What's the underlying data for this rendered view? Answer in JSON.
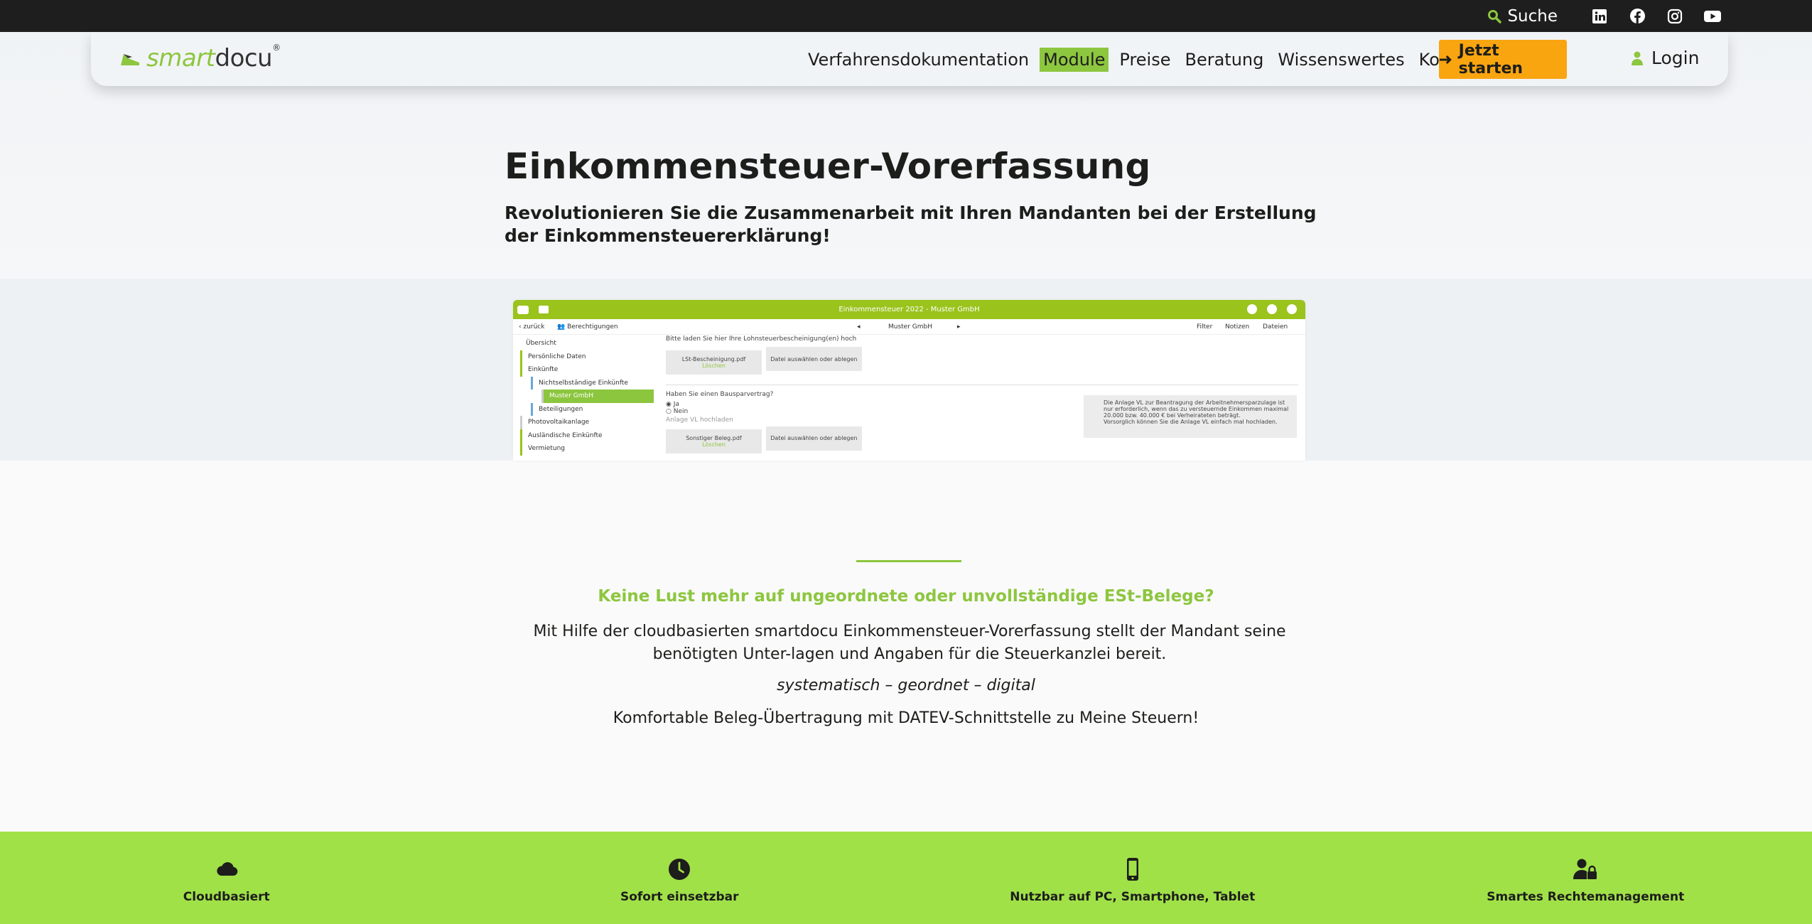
{
  "topbar": {
    "search_label": "Suche",
    "social": [
      "linkedin-icon",
      "facebook-icon",
      "instagram-icon",
      "youtube-icon"
    ]
  },
  "nav": {
    "logo_part1": "smart",
    "logo_part2": "docu",
    "logo_reg": "®",
    "items": [
      "Verfahrensdokumentation",
      "Module",
      "Preise",
      "Beratung",
      "Wissenswertes",
      "Kontakt"
    ],
    "active_item": "Module",
    "cta_label": "Jetzt starten",
    "login_label": "Login"
  },
  "hero": {
    "title": "Einkommensteuer-Vorerfassung",
    "subtitle": "Revolutionieren Sie die Zusammenarbeit mit Ihren Mandanten bei der Erstellung der Einkommensteuererklärung!"
  },
  "app_screenshot": {
    "window_title": "Einkommensteuer 2022 - Muster GmbH",
    "back_label": "zurück",
    "permissions_label": "Berechtigungen",
    "client_label": "Muster GmbH",
    "toolbar": [
      "Filter",
      "Notizen",
      "Dateien"
    ],
    "sidebar": [
      "Übersicht",
      "Persönliche Daten",
      "Einkünfte",
      "Nichtselbständige Einkünfte",
      "Muster GmbH",
      "Beteiligungen",
      "Photovoltaikanlage",
      "Ausländische Einkünfte",
      "Vermietung"
    ],
    "upload_prompt": "Bitte laden Sie hier Ihre Lohnsteuerbescheinigung(en) hoch",
    "file1_name": "LSt-Bescheinigung.pdf",
    "file1_action": "Löschen",
    "upload_label": "Datei auswählen oder ablegen",
    "question": "Haben Sie einen Bausparvertrag?",
    "option_yes": "Ja",
    "option_no": "Nein",
    "vl_label": "Anlage VL hochladen",
    "file2_name": "Sonstiger Beleg.pdf",
    "file2_action": "Löschen",
    "hint_text": "Die Anlage VL zur Beantragung der Arbeitnehmersparzulage ist nur erforderlich, wenn das zu versteuernde Einkommen maximal 20.000 bzw. 40.000 € bei Verheirateten beträgt.",
    "hint_text2": "Vorsorglich können Sie die Anlage VL einfach mal hochladen."
  },
  "info": {
    "headline": "Keine Lust mehr auf ungeordnete oder unvollständige ESt-Belege?",
    "paragraph": "Mit Hilfe der cloudbasierten smartdocu Einkommensteuer-Vorerfassung stellt der Mandant seine benötigten Unter-lagen und Angaben für die Steuerkanzlei bereit.",
    "slogan": "systematisch – geordnet – digital",
    "datev_prefix": "Komfortable Beleg-Übertragung mit ",
    "datev_link": "DATEV-Schnittstelle",
    "datev_suffix": " zu Meine Steuern!"
  },
  "features": [
    {
      "icon": "cloud-icon",
      "label": "Cloudbasiert"
    },
    {
      "icon": "clock-icon",
      "label": "Sofort einsetzbar"
    },
    {
      "icon": "smartphone-icon",
      "label": "Nutzbar auf PC, Smartphone, Tablet"
    },
    {
      "icon": "user-lock-icon",
      "label": "Smartes Rechtemanagement"
    }
  ],
  "colors": {
    "brand_green": "#8dc63f",
    "feature_band": "#a0e148",
    "cta_orange": "#f9a510",
    "topbar": "#1e1e1e"
  }
}
